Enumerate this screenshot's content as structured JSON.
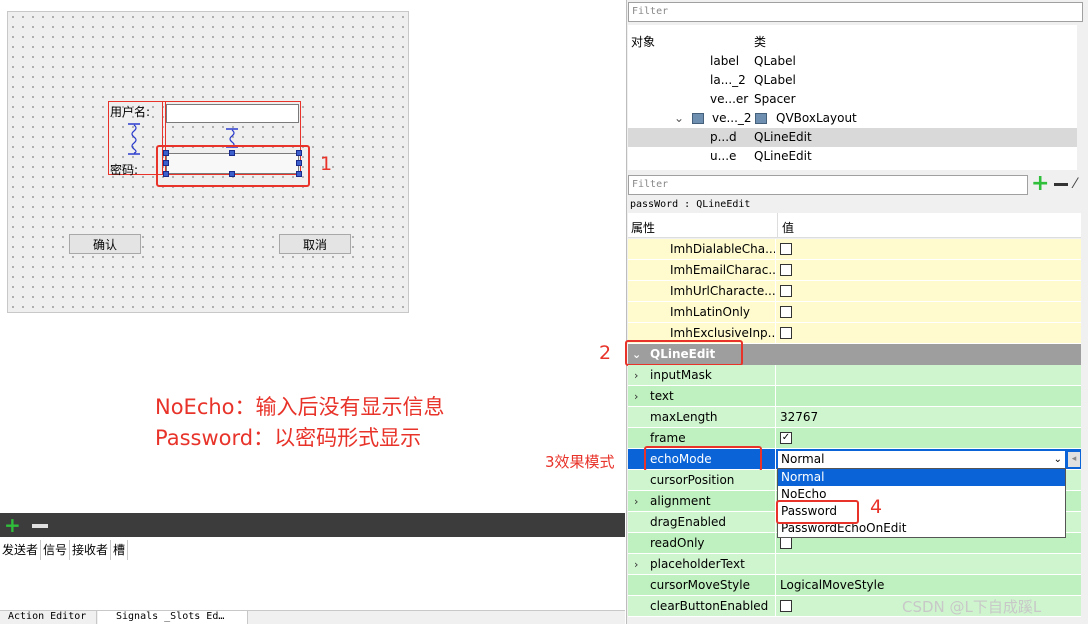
{
  "form": {
    "username_label": "用户名:",
    "password_label": "密码:",
    "confirm_button": "确认",
    "cancel_button": "取消"
  },
  "annotations": {
    "note_line1": "NoEcho：输入后没有显示信息",
    "note_line2": "Password：以密码形式显示",
    "tag1": "1",
    "tag2": "2",
    "tag3": "3效果模式",
    "tag4": "4"
  },
  "signals_panel": {
    "headers": [
      "发送者",
      "信号",
      "接收者",
      "槽"
    ],
    "tab_action_editor": "Action Editor",
    "tab_signals_slots": "Signals _Slots Ed…"
  },
  "object_inspector": {
    "filter_placeholder": "Filter",
    "col_object": "对象",
    "col_class": "类",
    "rows": [
      {
        "name": "label",
        "class": "QLabel"
      },
      {
        "name": "la..._2",
        "class": "QLabel"
      },
      {
        "name": "ve...er",
        "class": "Spacer"
      },
      {
        "name": "ve..._2",
        "class": "QVBoxLayout"
      },
      {
        "name": "p...d",
        "class": "QLineEdit"
      },
      {
        "name": "u...e",
        "class": "QLineEdit"
      }
    ]
  },
  "property_editor": {
    "filter_placeholder": "Filter",
    "object_title": "passWord : QLineEdit",
    "col_property": "属性",
    "col_value": "值",
    "imh_rows": [
      "ImhDialableCha...",
      "ImhEmailCharac...",
      "ImhUrlCharacte...",
      "ImhLatinOnly",
      "ImhExclusiveInp..."
    ],
    "section": "QLineEdit",
    "props": [
      {
        "name": "inputMask",
        "value": ""
      },
      {
        "name": "text",
        "value": ""
      },
      {
        "name": "maxLength",
        "value": "32767"
      },
      {
        "name": "frame",
        "value": "✓"
      },
      {
        "name": "echoMode",
        "value": "Normal"
      },
      {
        "name": "cursorPosition",
        "value": ""
      },
      {
        "name": "alignment",
        "value": ""
      },
      {
        "name": "dragEnabled",
        "value": ""
      },
      {
        "name": "readOnly",
        "value": ""
      },
      {
        "name": "placeholderText",
        "value": ""
      },
      {
        "name": "cursorMoveStyle",
        "value": "LogicalMoveStyle"
      },
      {
        "name": "clearButtonEnabled",
        "value": ""
      }
    ],
    "echo_options": [
      "Normal",
      "NoEcho",
      "Password",
      "PasswordEchoOnEdit"
    ]
  },
  "watermark": "CSDN @L下自成蹊L"
}
